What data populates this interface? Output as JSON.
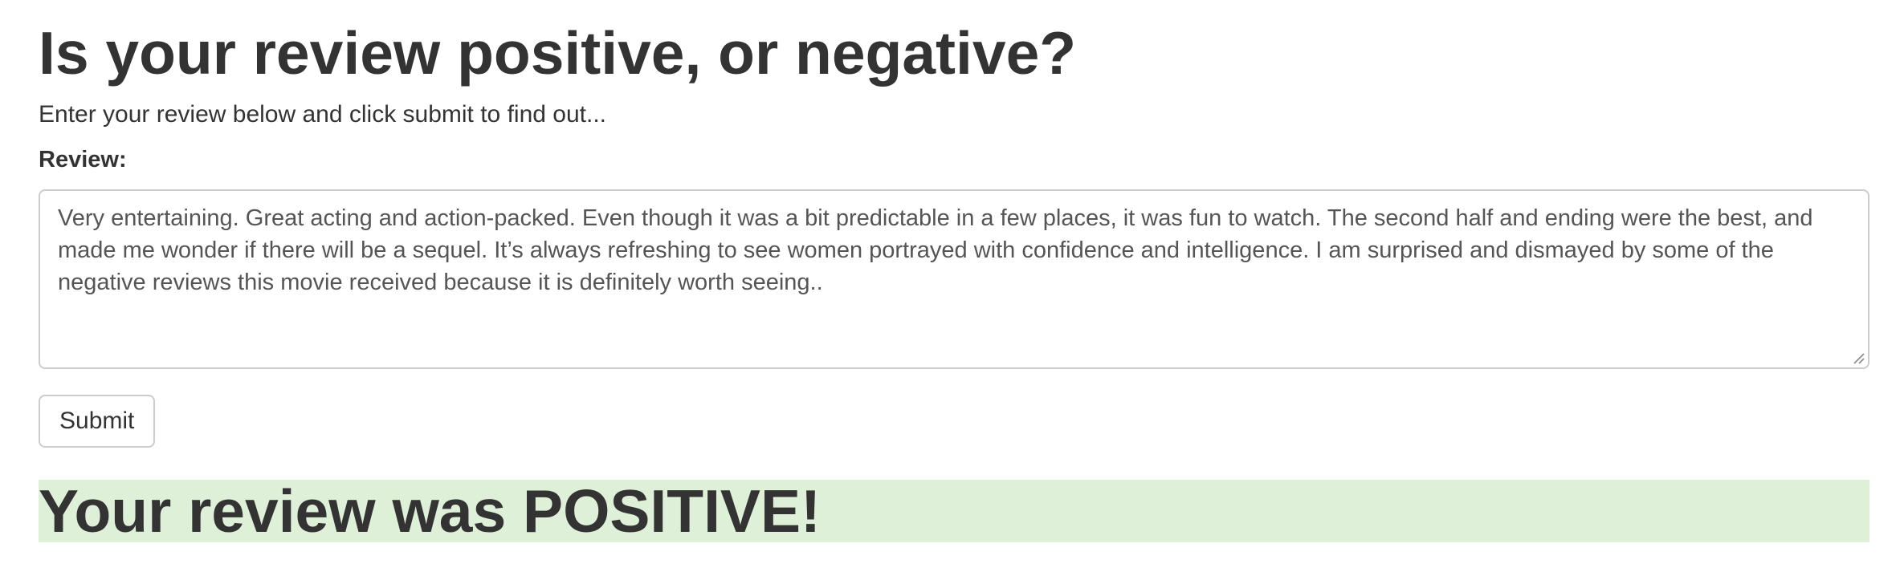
{
  "page": {
    "title": "Is your review positive, or negative?",
    "intro": "Enter your review below and click submit to find out..."
  },
  "form": {
    "review_label": "Review:",
    "review_value": "Very entertaining. Great acting and action-packed. Even though it was a bit predictable in a few places, it was fun to watch. The second half and ending were the best, and made me wonder if there will be a sequel. It’s always refreshing to see women portrayed with confidence and intelligence. I am surprised and dismayed by some of the negative reviews this movie received because it is definitely worth seeing..",
    "submit_label": "Submit"
  },
  "result": {
    "text": "Your review was POSITIVE!",
    "background_color": "#dff0d8"
  },
  "icons": {
    "resize_grip": "resize-grip-icon"
  }
}
